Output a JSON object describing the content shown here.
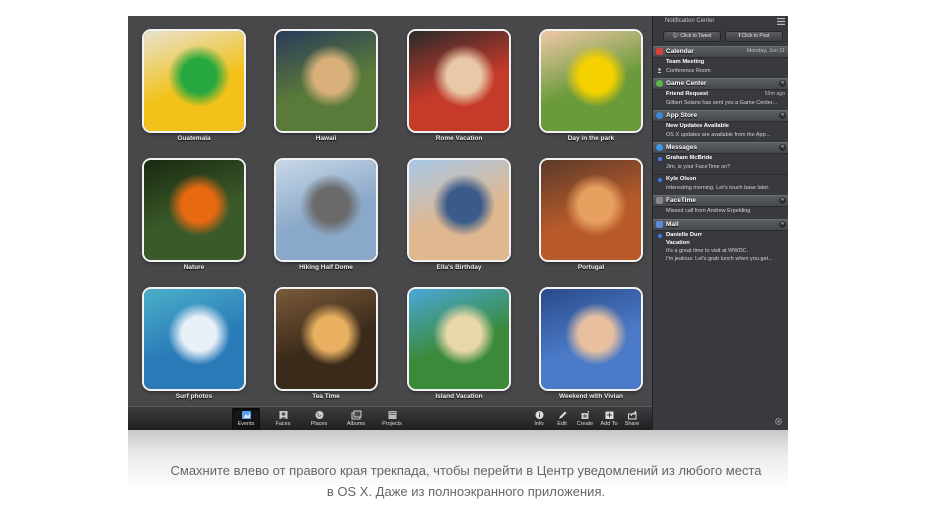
{
  "iphoto": {
    "events": [
      {
        "label": "Guatemala",
        "colors": [
          "#f2c21a",
          "#27a83f",
          "#e8e2cf"
        ]
      },
      {
        "label": "Hawaii",
        "colors": [
          "#5a7a3a",
          "#d9b07a",
          "#2a3a5a"
        ]
      },
      {
        "label": "Rome Vacation",
        "colors": [
          "#c63a2a",
          "#e8c8a8",
          "#2a2a2a"
        ]
      },
      {
        "label": "Day in the park",
        "colors": [
          "#6a9a3a",
          "#f5d100",
          "#f0c8a8"
        ]
      },
      {
        "label": "Nature",
        "colors": [
          "#3a5a2a",
          "#e86a10",
          "#1a2a10"
        ]
      },
      {
        "label": "Hiking Half Dome",
        "colors": [
          "#8aa8c8",
          "#6a6a6a",
          "#c8d8e8"
        ]
      },
      {
        "label": "Ella's Birthday",
        "colors": [
          "#e0b890",
          "#3a5a8a",
          "#a8c8e8"
        ]
      },
      {
        "label": "Portugal",
        "colors": [
          "#b85a2a",
          "#e8a060",
          "#5a3a2a"
        ]
      },
      {
        "label": "Surf photos",
        "colors": [
          "#2a7ab8",
          "#e8f0f8",
          "#4ab0c8"
        ]
      },
      {
        "label": "Tea Time",
        "colors": [
          "#3a2a1a",
          "#e8b060",
          "#7a5a3a"
        ]
      },
      {
        "label": "Island Vacation",
        "colors": [
          "#3a8a3a",
          "#e8d8a8",
          "#4aa8d8"
        ]
      },
      {
        "label": "Weekend with Vivian",
        "colors": [
          "#4a7ac8",
          "#e8c0a0",
          "#2a4a8a"
        ]
      }
    ]
  },
  "toolbar": {
    "left": [
      {
        "label": "Events",
        "icon": "events-icon"
      },
      {
        "label": "Faces",
        "icon": "faces-icon"
      },
      {
        "label": "Places",
        "icon": "places-icon"
      },
      {
        "label": "Albums",
        "icon": "albums-icon"
      },
      {
        "label": "Projects",
        "icon": "projects-icon"
      }
    ],
    "right": [
      {
        "label": "Info",
        "icon": "info-icon"
      },
      {
        "label": "Edit",
        "icon": "edit-icon"
      },
      {
        "label": "Create",
        "icon": "create-icon"
      },
      {
        "label": "Add To",
        "icon": "add-to-icon"
      },
      {
        "label": "Share",
        "icon": "share-icon"
      }
    ]
  },
  "notification_center": {
    "title": "Notification Center",
    "tweet_button": "Click to Tweet",
    "post_button": "Click to Post",
    "calendar": {
      "title": "Calendar",
      "date": "Monday, Jun 11",
      "event_title": "Team Meeting",
      "event_place": "Conference Room"
    },
    "game_center": {
      "title": "Game Center",
      "item_title": "Friend Request",
      "item_time": "59m ago",
      "item_text": "Gilbert Solano has sent you a Game Center..."
    },
    "app_store": {
      "title": "App Store",
      "item_title": "New Updates Available",
      "item_text": "OS X updates are available from the App..."
    },
    "messages": {
      "title": "Messages",
      "items": [
        {
          "name": "Graham McBride",
          "text": "Jim, is your FaceTime on?"
        },
        {
          "name": "Kyle Olson",
          "text": "Interesting morning. Let's touch base later."
        }
      ]
    },
    "facetime": {
      "title": "FaceTime",
      "item_text": "Missed call from Andrew Erpelding"
    },
    "mail": {
      "title": "Mail",
      "item_name": "Danielle Durr",
      "item_subject": "Vacation",
      "item_line1": "It's a great time to visit at WWDC.",
      "item_line2": "I'm jealous. Let's grab lunch when you get..."
    }
  },
  "caption": {
    "line1": "Смахните влево от правого края трекпада, чтобы перейти в Центр уведомлений из любого места",
    "line2": "в OS X. Даже из полноэкранного приложения."
  },
  "colors": {
    "accent_blue": "#3f7fe8",
    "calendar_red": "#d8403a",
    "game_center_green": "#5ab84a",
    "app_store_blue": "#3a8ad8",
    "messages_blue": "#3a9ae8",
    "facetime_gray": "#8a8a8a",
    "mail_blue": "#5a8ad8"
  }
}
